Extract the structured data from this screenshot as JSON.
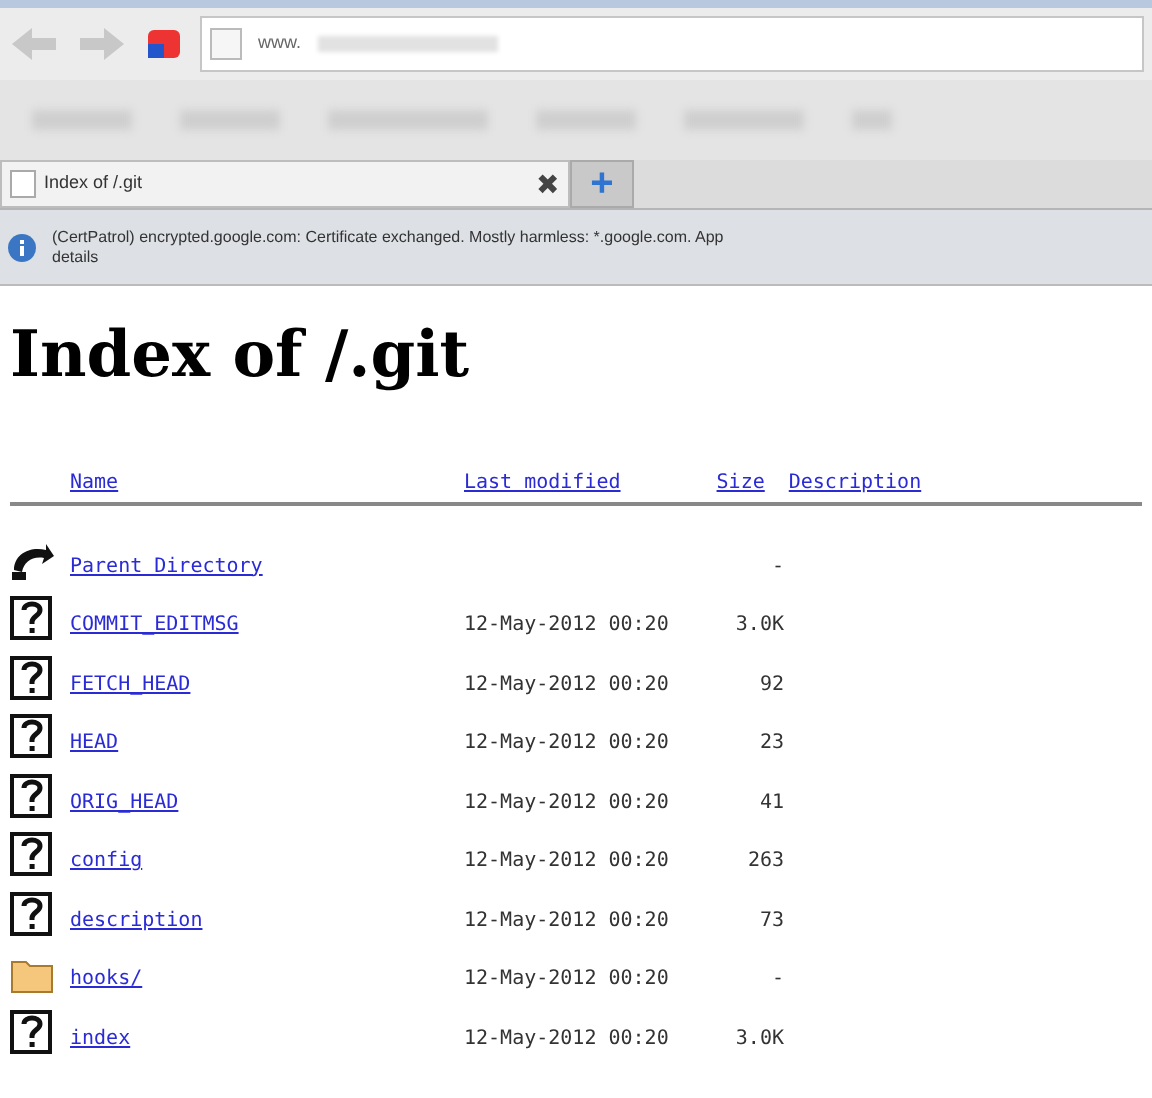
{
  "browser": {
    "address": "www.",
    "tab": {
      "title": "Index of /.git",
      "selected": true,
      "close": "✖",
      "new_tab": "+"
    },
    "info_bar": {
      "message": "(CertPatrol) encrypted.google.com: Certificate exchanged. Mostly harmless: *.google.com. App",
      "details": "details"
    }
  },
  "page": {
    "title": "Index of /.git",
    "columns": [
      "Name",
      "Last modified",
      "Size",
      "Description"
    ],
    "rows": [
      {
        "kind": "parent",
        "name": "Parent Directory",
        "modified": "",
        "size": "-"
      },
      {
        "kind": "file",
        "name": "COMMIT_EDITMSG",
        "modified": "12-May-2012 00:20",
        "size": "3.0K"
      },
      {
        "kind": "file",
        "name": "FETCH_HEAD",
        "modified": "12-May-2012 00:20",
        "size": "92"
      },
      {
        "kind": "file",
        "name": "HEAD",
        "modified": "12-May-2012 00:20",
        "size": "23"
      },
      {
        "kind": "file",
        "name": "ORIG_HEAD",
        "modified": "12-May-2012 00:20",
        "size": "41"
      },
      {
        "kind": "file",
        "name": "config",
        "modified": "12-May-2012 00:20",
        "size": "263"
      },
      {
        "kind": "file",
        "name": "description",
        "modified": "12-May-2012 00:20",
        "size": "73"
      },
      {
        "kind": "folder",
        "name": "hooks/",
        "modified": "12-May-2012 00:20",
        "size": "-"
      },
      {
        "kind": "file",
        "name": "index",
        "modified": "12-May-2012 00:20",
        "size": "3.0K"
      }
    ]
  }
}
